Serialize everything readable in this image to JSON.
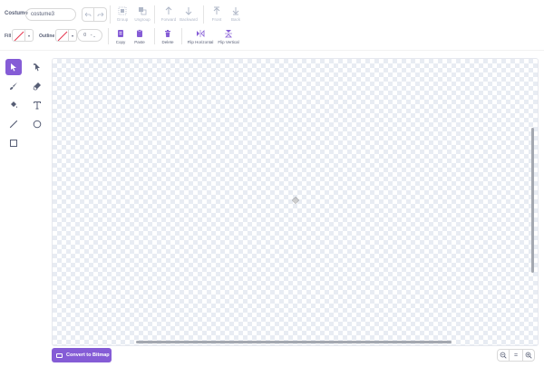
{
  "costume": {
    "label": "Costume",
    "name": "costume3"
  },
  "history": {
    "undo_icon": "undo-icon",
    "redo_icon": "redo-icon"
  },
  "arrange": {
    "group": "Group",
    "ungroup": "Ungroup",
    "forward": "Forward",
    "backward": "Backward",
    "front": "Front",
    "back": "Back"
  },
  "edit": {
    "copy": "Copy",
    "paste": "Paste",
    "delete": "Delete",
    "flip_horizontal": "Flip Horizontal",
    "flip_vertical": "Flip Vertical"
  },
  "style": {
    "fill_label": "Fill",
    "outline_label": "Outline",
    "stroke_width": "0",
    "stroke_stepper": "⌃⌄"
  },
  "tools": [
    "select",
    "reshape",
    "brush",
    "eraser",
    "fill",
    "text",
    "line",
    "circle",
    "rectangle"
  ],
  "convert": {
    "label": "Convert to Bitmap"
  },
  "zoom": {
    "out": "−",
    "reset": "=",
    "in": "+"
  },
  "colors": {
    "accent": "#855cd6",
    "text": "#575e75",
    "disabled": "#b0b8c8",
    "checker": "#e8ecf3",
    "no_color_slash": "#e5334c"
  }
}
